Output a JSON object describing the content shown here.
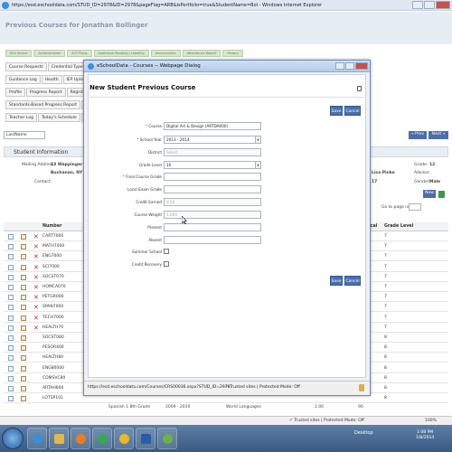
{
  "browser": {
    "title": "https://esd.eschooldata.com/STUD_ID=2978&ID=2978&pageFlag=ARB&isPortfolio=true&StudentName=Bol - Windows Internet Explorer",
    "status_text": "Trusted sites | Protected Mode: Off",
    "zoom": "100%"
  },
  "app": {
    "title": "Previous Courses for Jonathan Bollinger",
    "nav": [
      "504 School",
      "Achievements",
      "ACT Plans",
      "Additional Reading / Labeling",
      "Assessments",
      "Attendance Report",
      "History"
    ],
    "tabs_row1": [
      "Course Requests",
      "Credential Type",
      "Di"
    ],
    "tabs_row2": [
      "Guidance Log",
      "Health",
      "IEP Upload"
    ],
    "tabs_row3": [
      "Profile",
      "Progress Report",
      "Registration"
    ],
    "tabs_row4": [
      "Standards-Based Progress Report",
      "Standards"
    ],
    "tabs_row5": [
      "Teacher Log",
      "Today's Schedule",
      "Tran"
    ]
  },
  "filter": {
    "select_value": "LastName",
    "prev_label": "« Prev",
    "next_label": "Next »"
  },
  "student_info": {
    "heading": "Student Information",
    "mailing_label": "Mailing Address:",
    "mailing_value": "13 Wappinger Trail",
    "city": "Buchanan, NY 1051",
    "contact_label": "Contact:",
    "right_name": "Lisa Pinke",
    "right_num": "17",
    "grade_label": "Grade:",
    "grade_value": "12",
    "advisor_label": "Advisor:",
    "gender_label": "Gender:",
    "gender_value": "Male"
  },
  "grid": {
    "new_label": "New",
    "goto_label": "Go to page no.",
    "col_number": "Number",
    "col_cal": "ical",
    "col_grade": "Grade Level",
    "rows": [
      {
        "num": "CART7000",
        "grade": "7",
        "x": true
      },
      {
        "num": "MATH7000",
        "grade": "7",
        "x": true
      },
      {
        "num": "ENG7000",
        "grade": "7",
        "x": true
      },
      {
        "num": "SCI7000",
        "grade": "7",
        "x": true
      },
      {
        "num": "SOCST070",
        "grade": "7",
        "x": true
      },
      {
        "num": "HOMCA070",
        "grade": "7",
        "x": true
      },
      {
        "num": "PETGR000",
        "grade": "7",
        "x": true
      },
      {
        "num": "SPAN7000",
        "grade": "7",
        "x": true
      },
      {
        "num": "TECH7000",
        "grade": "7",
        "x": true
      },
      {
        "num": "HEALTH70",
        "grade": "7",
        "x": true
      },
      {
        "num": "SOCST080",
        "grade": "8",
        "x": false
      },
      {
        "num": "PESOR400",
        "grade": "8",
        "x": false
      },
      {
        "num": "HEALTH80",
        "grade": "8",
        "x": false
      },
      {
        "num": "ENG80000",
        "grade": "8",
        "x": false
      },
      {
        "num": "COMSVC80",
        "grade": "8",
        "x": false
      },
      {
        "num": "ARTAH600",
        "grade": "8",
        "x": false
      },
      {
        "num": "LOTSP101",
        "grade": "8",
        "x": false
      }
    ],
    "last_row": {
      "desc": "Spanish 1 8th Grade",
      "years": "2009 - 2010",
      "dept": "World Languages",
      "val1": "1.00",
      "val2": "90"
    }
  },
  "dialog": {
    "window_title": "eSchoolData - Courses -- Webpage Dialog",
    "heading": "New Student Previous Course",
    "save_label": "Save",
    "cancel_label": "Cancel",
    "url": "https://esd.eschooldata.com/Courses/CRS00036.aspx?STUD_ID=2978",
    "status": "Trusted sites | Protected Mode: Off",
    "fields": {
      "course_label": "Course",
      "course_value": "Digital Art & Design (ARTDA000)",
      "school_year_label": "School Year",
      "school_year_value": "2013 - 2014",
      "district_label": "District",
      "district_placeholder": "Select",
      "grade_level_label": "Grade Level",
      "grade_level_value": "10",
      "final_grade_label": "Final Course Grade",
      "local_exam_label": "Local Exam Grade",
      "credit_earned_label": "Credit Earned",
      "credit_earned_value": "0.50",
      "course_weight_label": "Course Weight",
      "course_weight_value": "1.000",
      "present_label": "Present",
      "absent_label": "Absent",
      "summer_school_label": "Summer School",
      "credit_recovery_label": "Credit Recovery"
    }
  },
  "taskbar": {
    "desktop_label": "Desktop",
    "time": "1:08 PM",
    "date": "1/8/2014"
  }
}
